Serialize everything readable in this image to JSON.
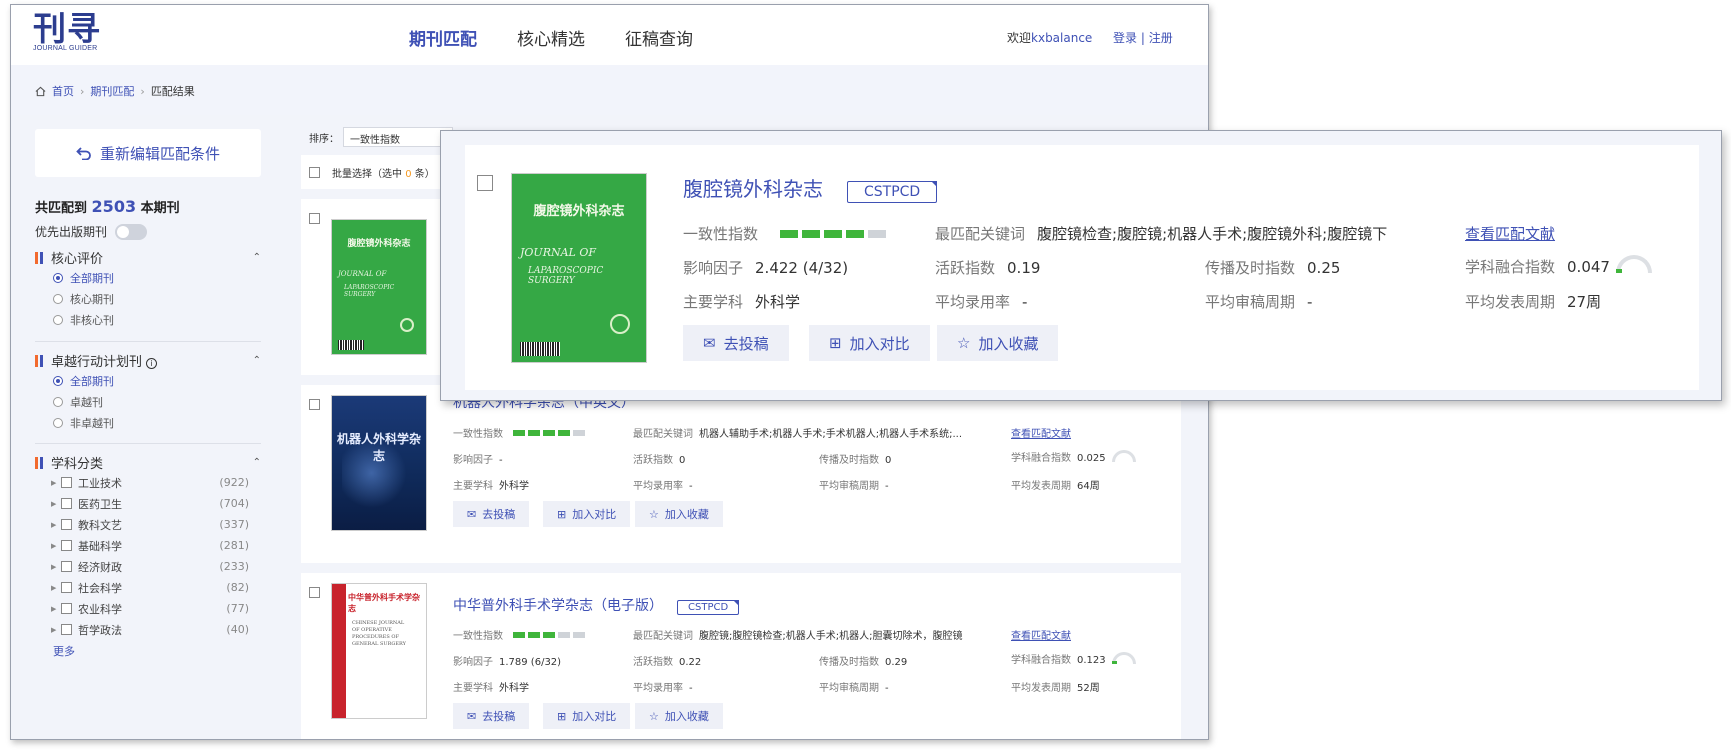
{
  "header": {
    "logo_cn": "刊寻",
    "logo_en": "JOURNAL GUIDER",
    "nav": [
      "期刊匹配",
      "核心精选",
      "征稿查询"
    ],
    "welcome_prefix": "欢迎",
    "username": "kxbalance",
    "login": "登录",
    "register": "注册",
    "auth_sep": " | "
  },
  "breadcrumb": [
    "首页",
    "期刊匹配",
    "匹配结果"
  ],
  "sidebar": {
    "reedit_label": "重新编辑匹配条件",
    "match_prefix": "共匹配到",
    "match_count": "2503",
    "match_suffix": "本期刊",
    "prefer_label": "优先出版期刊",
    "core_eval": {
      "title": "核心评价",
      "options": [
        "全部期刊",
        "核心期刊",
        "非核心刊"
      ],
      "selected": 0
    },
    "excellence": {
      "title": "卓越行动计划刊",
      "options": [
        "全部期刊",
        "卓越刊",
        "非卓越刊"
      ],
      "selected": 0
    },
    "subject": {
      "title": "学科分类",
      "items": [
        {
          "label": "工业技术",
          "count": "(922)"
        },
        {
          "label": "医药卫生",
          "count": "(704)"
        },
        {
          "label": "教科文艺",
          "count": "(337)"
        },
        {
          "label": "基础科学",
          "count": "(281)"
        },
        {
          "label": "经济财政",
          "count": "(233)"
        },
        {
          "label": "社会科学",
          "count": "(82)"
        },
        {
          "label": "农业科学",
          "count": "(77)"
        },
        {
          "label": "哲学政法",
          "count": "(40)"
        }
      ],
      "more": "更多"
    }
  },
  "results": {
    "sort_label": "排序：",
    "sort_value": "一致性指数",
    "batch_prefix": "批量选择（选中",
    "batch_count": "0",
    "batch_suffix": "条）",
    "labels": {
      "consistency": "一致性指数",
      "keywords": "最匹配关键词",
      "view_refs": "查看匹配文献",
      "impact": "影响因子",
      "active": "活跃指数",
      "spread": "传播及时指数",
      "fusion": "学科融合指数",
      "subject": "主要学科",
      "accept": "平均录用率",
      "review": "平均审稿周期",
      "publish": "平均发表周期",
      "submit": "去投稿",
      "compare": "加入对比",
      "favorite": "加入收藏"
    },
    "journals": [
      {
        "title": "腹腔镜外科杂志",
        "tag": "CSTPCD",
        "consistency_level": 4,
        "keywords": "腹腔镜检查;腹腔镜;机器人手术;腹腔镜外科;腹腔镜下",
        "impact": "2.422 (4/32)",
        "active": "0.19",
        "spread": "0.25",
        "fusion": "0.047",
        "subject": "外科学",
        "accept": "-",
        "review": "-",
        "publish": "27周",
        "cover_cn": "腹腔镜外科杂志",
        "cover_en_1": "JOURNAL OF",
        "cover_en_2": "LAPAROSCOPIC SURGERY"
      },
      {
        "title": "机器人外科学杂志（中英文）",
        "tag": "",
        "consistency_level": 4,
        "keywords": "机器人辅助手术;机器人手术;手术机器人;机器人手术系统;...",
        "impact": "-",
        "active": "0",
        "spread": "0",
        "fusion": "0.025",
        "subject": "外科学",
        "accept": "-",
        "review": "-",
        "publish": "64周",
        "cover_cn": "机器人外科学杂志"
      },
      {
        "title": "中华普外科手术学杂志（电子版）",
        "tag": "CSTPCD",
        "consistency_level": 3,
        "keywords": "腹腔镜;腹腔镜检查;机器人手术;机器人;胆囊切除术，腹腔镜",
        "impact": "1.789 (6/32)",
        "active": "0.22",
        "spread": "0.29",
        "fusion": "0.123",
        "subject": "外科学",
        "accept": "-",
        "review": "-",
        "publish": "52周",
        "cover_cn": "中华普外科手术学杂志",
        "cover_en": "CHINESE JOURNAL OF OPERATIVE PROCEDURES OF GENERAL SURGERY"
      }
    ]
  },
  "colors": {
    "primary": "#3f51b5",
    "accent_green": "#3fb53b",
    "highlight": "#f59a23",
    "cover_green": "#35a845",
    "cover_red": "#c8232c"
  }
}
